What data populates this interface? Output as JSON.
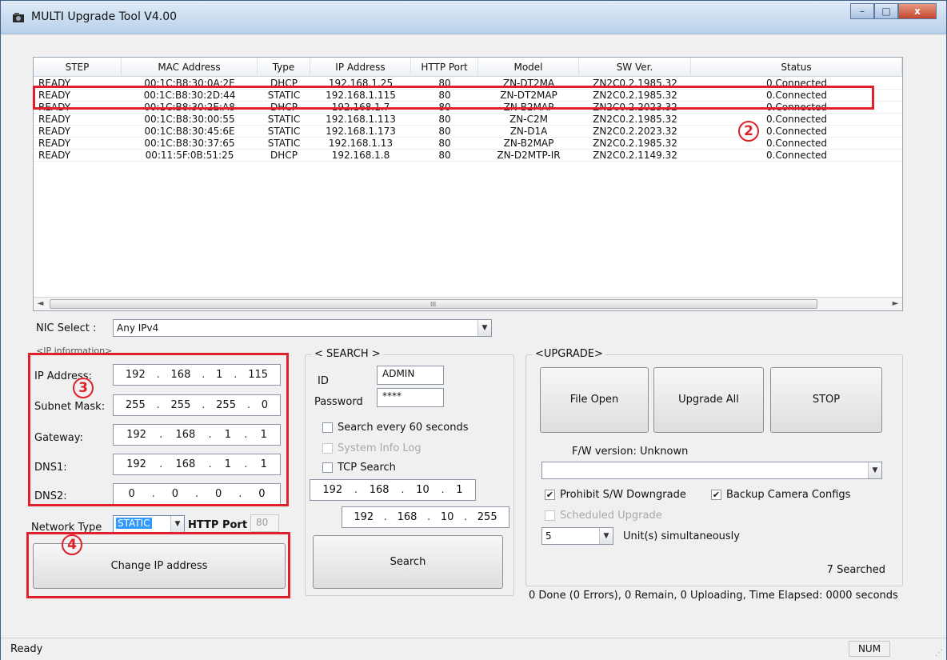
{
  "window": {
    "title": "MULTI Upgrade Tool V4.00",
    "minimize": "–",
    "maximize": "□",
    "close": "x"
  },
  "devices": {
    "columns": [
      "STEP",
      "MAC Address",
      "Type",
      "IP Address",
      "HTTP Port",
      "Model",
      "SW Ver.",
      "Status"
    ],
    "rows": [
      [
        "READY",
        "00:1C:B8:30:0A:2E",
        "DHCP",
        "192.168.1.25",
        "80",
        "ZN-DT2MA",
        "ZN2C0.2.1985.32",
        "0.Connected"
      ],
      [
        "READY",
        "00:1C:B8:30:2D:44",
        "STATIC",
        "192.168.1.115",
        "80",
        "ZN-DT2MAP",
        "ZN2C0.2.1985.32",
        "0.Connected"
      ],
      [
        "READY",
        "00:1C:B8:30:2E:A8",
        "DHCP",
        "192.168.1.7",
        "80",
        "ZN-B2MAP",
        "ZN2C0.2.2023.32",
        "0.Connected"
      ],
      [
        "READY",
        "00:1C:B8:30:00:55",
        "STATIC",
        "192.168.1.113",
        "80",
        "ZN-C2M",
        "ZN2C0.2.1985.32",
        "0.Connected"
      ],
      [
        "READY",
        "00:1C:B8:30:45:6E",
        "STATIC",
        "192.168.1.173",
        "80",
        "ZN-D1A",
        "ZN2C0.2.2023.32",
        "0.Connected"
      ],
      [
        "READY",
        "00:1C:B8:30:37:65",
        "STATIC",
        "192.168.1.13",
        "80",
        "ZN-B2MAP",
        "ZN2C0.2.1985.32",
        "0.Connected"
      ],
      [
        "READY",
        "00:11:5F:0B:51:25",
        "DHCP",
        "192.168.1.8",
        "80",
        "ZN-D2MTP-IR",
        "ZN2C0.2.1149.32",
        "0.Connected"
      ]
    ],
    "scroll_left": "◄",
    "scroll_right": "►",
    "scroll_grip": "III"
  },
  "callouts": {
    "two": "2",
    "three": "3",
    "four": "4"
  },
  "nic": {
    "label": "NIC Select :",
    "value": "Any IPv4"
  },
  "ip_info": {
    "title": "<IP information>",
    "ip_label": "IP Address:",
    "ip": [
      "192",
      "168",
      "1",
      "115"
    ],
    "subnet_label": "Subnet Mask:",
    "subnet": [
      "255",
      "255",
      "255",
      "0"
    ],
    "gateway_label": "Gateway:",
    "gateway": [
      "192",
      "168",
      "1",
      "1"
    ],
    "dns1_label": "DNS1:",
    "dns1": [
      "192",
      "168",
      "1",
      "1"
    ],
    "dns2_label": "DNS2:",
    "dns2": [
      "0",
      "0",
      "0",
      "0"
    ],
    "network_type_label": "Network Type",
    "network_type": "STATIC",
    "http_port_label": "HTTP Port",
    "http_port": "80",
    "change_button": "Change IP address"
  },
  "search": {
    "title": "< SEARCH >",
    "id_label": "ID",
    "id_value": "ADMIN",
    "password_label": "Password",
    "password_value": "****",
    "every60": "Search every 60 seconds",
    "sysinfo": "System Info Log",
    "tcp": "TCP Search",
    "start_ip": [
      "192",
      "168",
      "10",
      "1"
    ],
    "end_ip": [
      "192",
      "168",
      "10",
      "255"
    ],
    "search_button": "Search"
  },
  "upgrade": {
    "title": "<UPGRADE>",
    "file_open": "File Open",
    "upgrade_all": "Upgrade All",
    "stop": "STOP",
    "fw_version": "F/W version: Unknown",
    "prohibit": "Prohibit S/W Downgrade",
    "backup": "Backup Camera Configs",
    "scheduled": "Scheduled Upgrade",
    "units_value": "5",
    "units_label": "Unit(s) simultaneously",
    "searched": "7 Searched",
    "progress": "0 Done (0 Errors), 0 Remain, 0 Uploading, Time Elapsed: 0000 seconds"
  },
  "statusbar": {
    "text": "Ready",
    "num": "NUM"
  },
  "colors": {
    "callout_red": "#e0212c",
    "selection_blue": "#3399ff"
  }
}
